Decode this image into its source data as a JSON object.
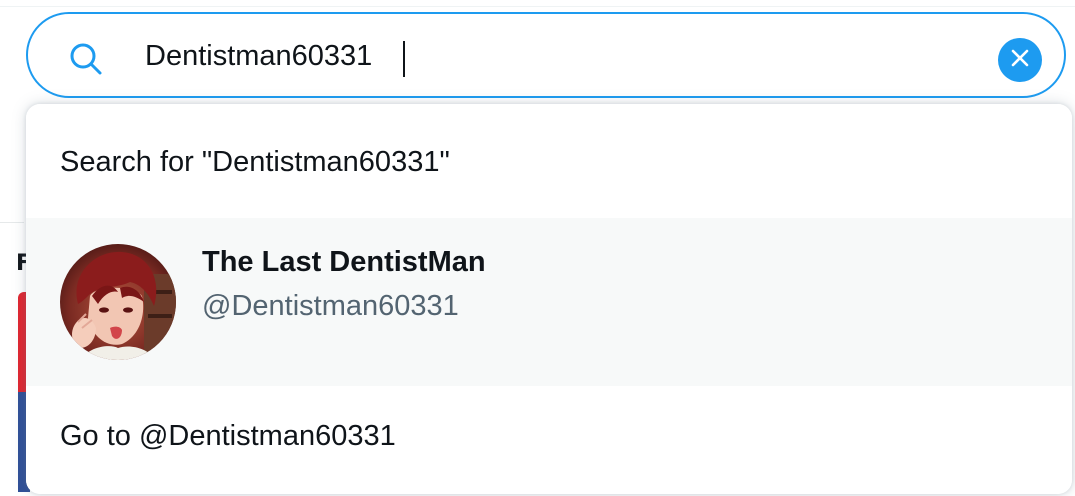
{
  "search": {
    "value": "Dentistman60331",
    "search_icon": "search-icon",
    "clear_icon": "close-icon"
  },
  "dropdown": {
    "search_for_label": "Search for \"Dentistman60331\"",
    "user": {
      "display_name": "The Last DentistMan",
      "handle": "@Dentistman60331",
      "avatar_icon": "avatar"
    },
    "goto_label": "Go to @Dentistman60331"
  },
  "colors": {
    "accent": "#1d9bf0",
    "text_primary": "#0f1419",
    "text_secondary": "#536471",
    "row_hover": "#f7f9f9"
  }
}
